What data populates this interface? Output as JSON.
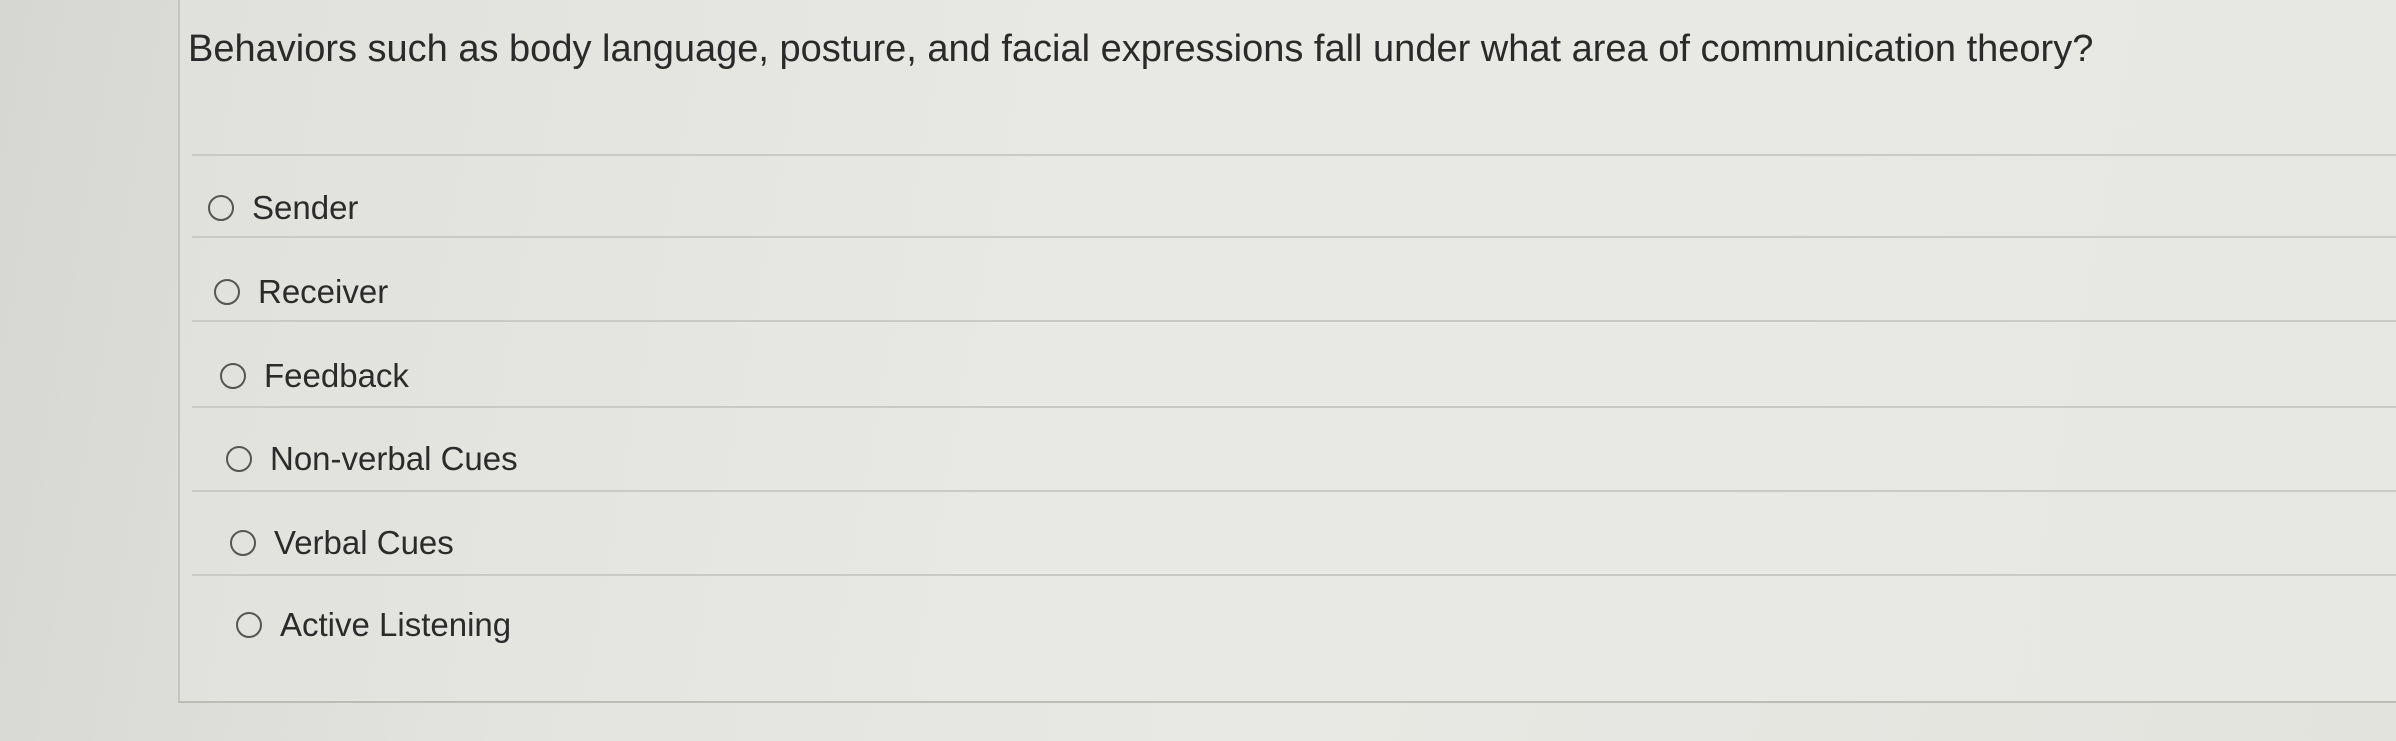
{
  "question": {
    "text": "Behaviors such as body language, posture, and facial expressions fall under what area of communication theory?"
  },
  "options": [
    {
      "label": "Sender",
      "selected": false
    },
    {
      "label": "Receiver",
      "selected": false
    },
    {
      "label": "Feedback",
      "selected": false
    },
    {
      "label": "Non-verbal Cues",
      "selected": false
    },
    {
      "label": "Verbal Cues",
      "selected": false
    },
    {
      "label": "Active Listening",
      "selected": false
    }
  ],
  "colors": {
    "background": "#e6e6e2",
    "text": "#2a2a2a",
    "radio_border": "#555555",
    "divider": "#c9c9c5"
  }
}
